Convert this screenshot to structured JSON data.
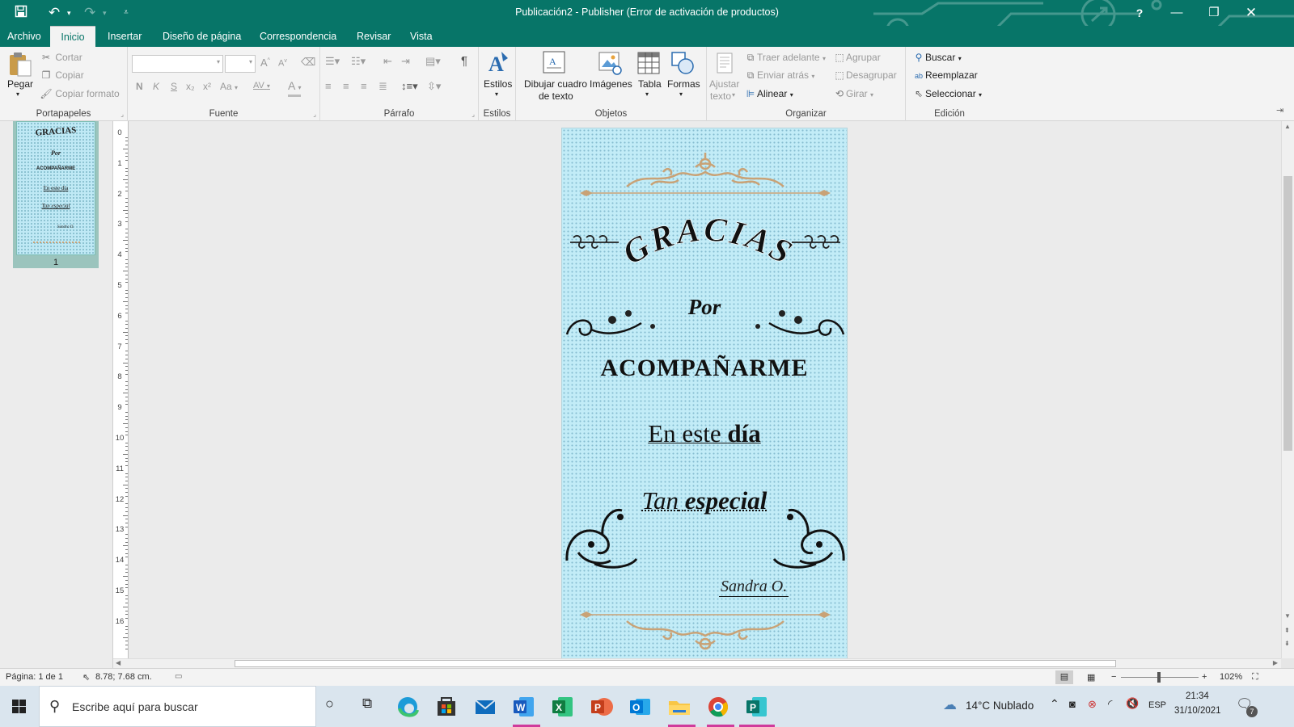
{
  "app": {
    "title": "Publicación2 - Publisher (Error de activación de productos)",
    "help": "?"
  },
  "tabs": [
    "Archivo",
    "Inicio",
    "Insertar",
    "Diseño de página",
    "Correspondencia",
    "Revisar",
    "Vista"
  ],
  "ribbon": {
    "clipboard": {
      "paste": "Pegar",
      "cut": "Cortar",
      "copy": "Copiar",
      "copy_format": "Copiar formato",
      "label": "Portapapeles"
    },
    "font": {
      "label": "Fuente",
      "bold": "N",
      "italic": "K",
      "underline": "S",
      "sub": "x₂",
      "sup": "x²",
      "case": "Aa",
      "spacing": "AV",
      "color": "A",
      "grow": "A",
      "shrink": "A"
    },
    "paragraph": {
      "label": "Párrafo",
      "pilcrow": "¶"
    },
    "styles": {
      "button": "Estilos",
      "label": "Estilos"
    },
    "objects": {
      "draw_textbox_1": "Dibujar cuadro",
      "draw_textbox_2": "de texto",
      "images": "Imágenes",
      "table": "Tabla",
      "shapes": "Formas",
      "label": "Objetos"
    },
    "arrange": {
      "wrap_1": "Ajustar",
      "wrap_2": "texto",
      "bring_forward": "Traer adelante",
      "send_backward": "Enviar atrás",
      "align": "Alinear",
      "group": "Agrupar",
      "ungroup": "Desagrupar",
      "rotate": "Girar",
      "label": "Organizar"
    },
    "editing": {
      "find": "Buscar",
      "replace": "Reemplazar",
      "select": "Seleccionar",
      "label": "Edición"
    }
  },
  "thumbnails": [
    {
      "number": "1",
      "lines": [
        "GRACIAS",
        "Por",
        "ACOMPAÑARME",
        "En este día",
        "Tan especial",
        "Sandra O."
      ]
    }
  ],
  "ruler": [
    "0",
    "1",
    "2",
    "3",
    "4",
    "5",
    "6",
    "7",
    "8",
    "9",
    "10",
    "11",
    "12",
    "13",
    "14",
    "15",
    "16"
  ],
  "page": {
    "gracias": "GRACIAS",
    "por": "Por",
    "acompanarme": "ACOMPAÑARME",
    "en_este": "En este",
    "dia": "día",
    "tan": "Tan",
    "especial": "especial",
    "signature": "Sandra O."
  },
  "status": {
    "page": "Página: 1 de 1",
    "position": "8.78; 7.68 cm.",
    "zoom": "102%"
  },
  "taskbar": {
    "search_placeholder": "Escribe aquí para buscar",
    "weather": "14°C  Nublado",
    "lang": "ESP",
    "time": "21:34",
    "date": "31/10/2021",
    "notifications": "7"
  },
  "colors": {
    "accent": "#077568",
    "page_bg": "#c2ecf7",
    "ornament_gold": "#c9a276"
  }
}
